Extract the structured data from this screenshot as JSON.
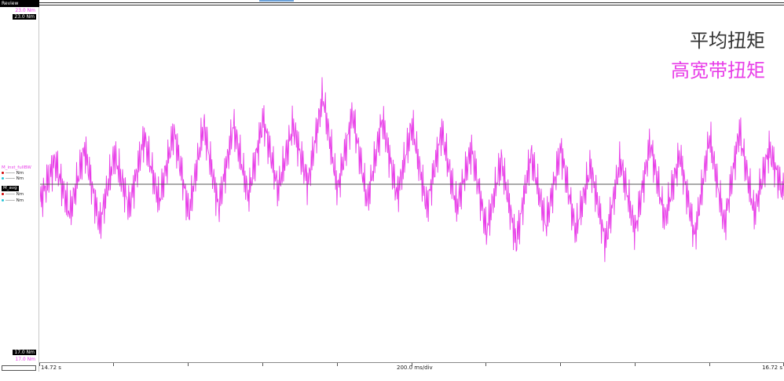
{
  "window": {
    "title": "Review"
  },
  "scale": {
    "top_max_magenta": "23.0  Nm",
    "top_max_black": "23.0  Nm",
    "bottom_min_black": "17.0  Nm",
    "bottom_min_magenta": "17.0  Nm"
  },
  "channels": [
    {
      "name": "M_inst_fullBW",
      "color": "#e83ee8",
      "row1": "------ Nm",
      "row2": "------ Nm"
    },
    {
      "name": "M_avg",
      "color": "#000000",
      "row1": "------ Nm",
      "row2": "------ Nm"
    }
  ],
  "legend": {
    "avg_label": "平均扭矩",
    "full_label": "高宽带扭矩"
  },
  "time_axis": {
    "left": "14.72 s",
    "center": "200.0 ms/div",
    "right": "16.72 s"
  },
  "colors": {
    "magenta": "#e83ee8",
    "avg_line": "#555555"
  },
  "chart_data": {
    "type": "line",
    "x_unit": "s",
    "xlim": [
      14.72,
      16.72
    ],
    "ylim": [
      17.0,
      23.0
    ],
    "series": [
      {
        "name": "M_inst_fullBW",
        "color": "#e83ee8",
        "x": [
          14.72,
          14.76,
          14.8,
          14.84,
          14.88,
          14.92,
          14.96,
          15.0,
          15.04,
          15.08,
          15.12,
          15.16,
          15.2,
          15.24,
          15.28,
          15.32,
          15.36,
          15.4,
          15.44,
          15.48,
          15.52,
          15.56,
          15.6,
          15.64,
          15.68,
          15.72,
          15.76,
          15.8,
          15.84,
          15.88,
          15.92,
          15.96,
          16.0,
          16.04,
          16.08,
          16.12,
          16.16,
          16.2,
          16.24,
          16.28,
          16.32,
          16.36,
          16.4,
          16.44,
          16.48,
          16.52,
          16.56,
          16.6,
          16.64,
          16.68,
          16.72
        ],
        "values": [
          19.7,
          20.4,
          19.5,
          20.6,
          19.3,
          20.5,
          19.6,
          20.8,
          19.7,
          20.9,
          19.5,
          21.0,
          19.6,
          21.0,
          19.8,
          21.1,
          19.9,
          21.0,
          20.0,
          21.5,
          19.9,
          21.2,
          19.7,
          21.1,
          19.8,
          21.0,
          19.6,
          20.9,
          19.6,
          20.6,
          19.2,
          20.4,
          19.0,
          20.5,
          19.3,
          20.6,
          19.2,
          20.3,
          19.0,
          20.4,
          19.2,
          20.7,
          19.4,
          20.5,
          19.1,
          20.8,
          19.3,
          20.9,
          19.5,
          20.6,
          19.8
        ]
      },
      {
        "name": "M_avg",
        "color": "#555555",
        "x": [
          14.72,
          16.72
        ],
        "values": [
          20.0,
          20.0
        ]
      }
    ]
  }
}
